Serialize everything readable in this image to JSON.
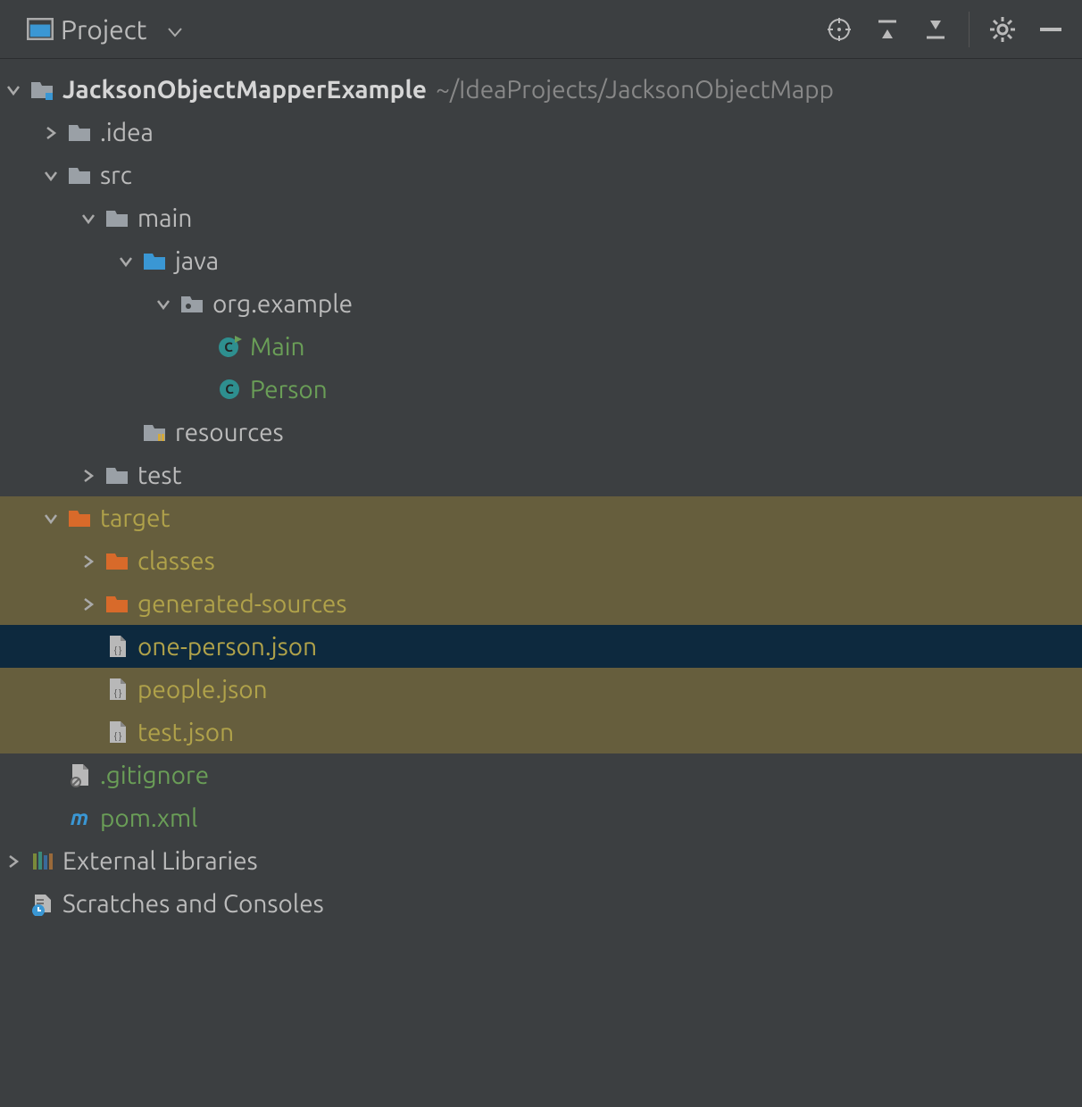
{
  "toolbar": {
    "title": "Project"
  },
  "tree": {
    "root": {
      "name": "JacksonObjectMapperExample",
      "path": "~/IdeaProjects/JacksonObjectMapp"
    },
    "idea": ".idea",
    "src": "src",
    "main": "main",
    "java": "java",
    "pkg": "org.example",
    "class_main": "Main",
    "class_person": "Person",
    "resources": "resources",
    "test": "test",
    "target": "target",
    "classes": "classes",
    "gensrc": "generated-sources",
    "oneperson": "one-person.json",
    "people": "people.json",
    "testjson": "test.json",
    "gitignore": ".gitignore",
    "pom": "pom.xml",
    "extlib": "External Libraries",
    "scratch": "Scratches and Consoles"
  }
}
